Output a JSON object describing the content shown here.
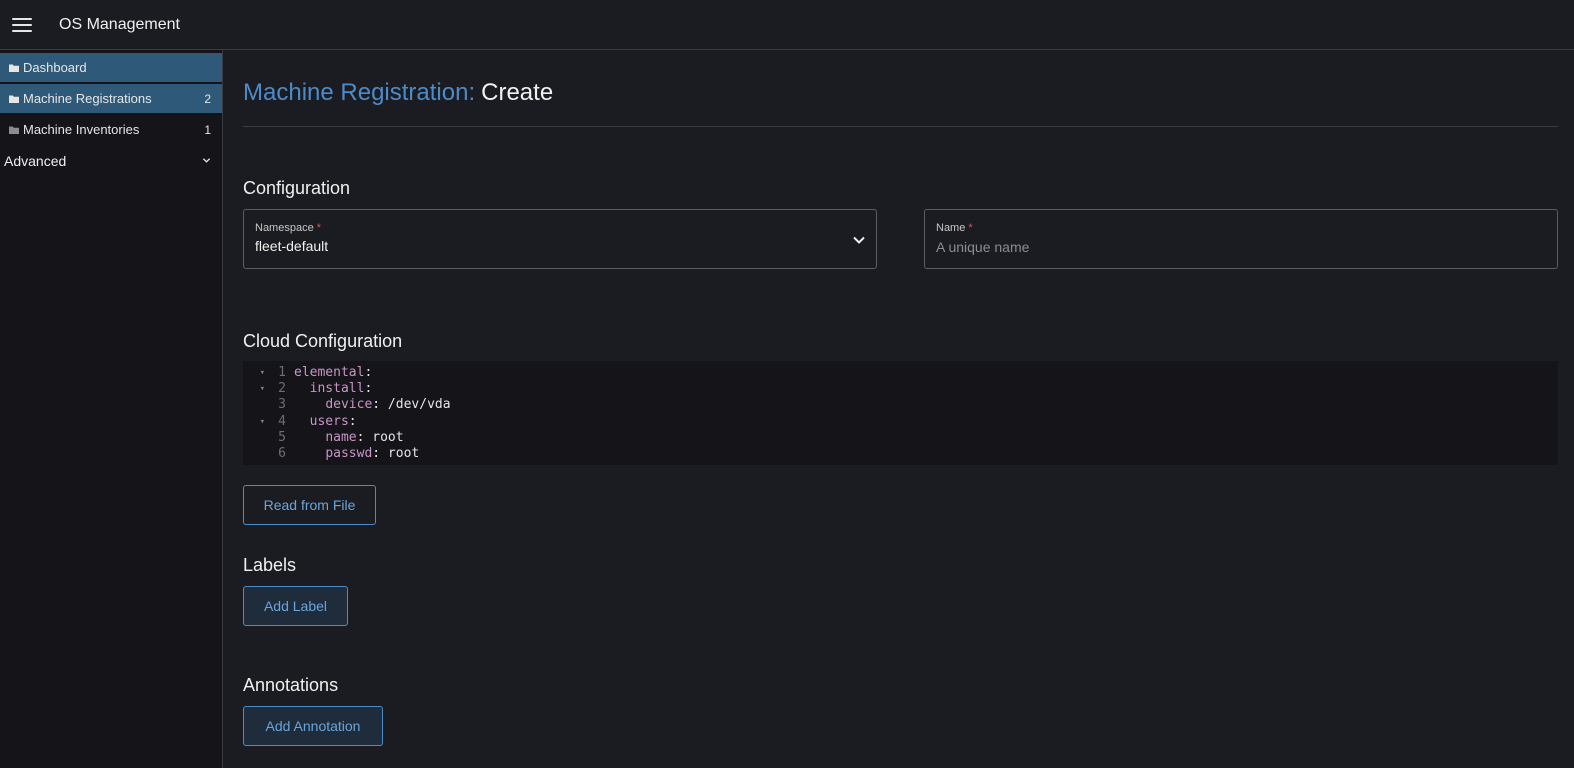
{
  "header": {
    "app_title": "OS Management"
  },
  "sidebar": {
    "items": [
      {
        "label": "Dashboard",
        "count": ""
      },
      {
        "label": "Machine Registrations",
        "count": "2"
      },
      {
        "label": "Machine Inventories",
        "count": "1"
      }
    ],
    "group": {
      "label": "Advanced"
    }
  },
  "page": {
    "title_prefix": "Machine Registration:",
    "title_action": "Create"
  },
  "configuration": {
    "title": "Configuration",
    "namespace": {
      "label": "Namespace",
      "value": "fleet-default"
    },
    "name": {
      "label": "Name",
      "placeholder": "A unique name",
      "value": ""
    }
  },
  "cloud_configuration": {
    "title": "Cloud Configuration",
    "lines": [
      {
        "no": "1",
        "indent": "",
        "key": "elemental",
        "rest": ":"
      },
      {
        "no": "2",
        "indent": "  ",
        "key": "install",
        "rest": ":"
      },
      {
        "no": "3",
        "indent": "    ",
        "key": "device",
        "rest": ": /dev/vda"
      },
      {
        "no": "4",
        "indent": "  ",
        "key": "users",
        "rest": ":"
      },
      {
        "no": "5",
        "indent": "    ",
        "key": "name",
        "rest": ": root"
      },
      {
        "no": "6",
        "indent": "    ",
        "key": "passwd",
        "rest": ": root"
      }
    ],
    "read_button": "Read from File"
  },
  "labels": {
    "title": "Labels",
    "add_button": "Add Label"
  },
  "annotations": {
    "title": "Annotations",
    "add_button": "Add Annotation"
  },
  "colors": {
    "accent": "#4c8bc9",
    "active_nav": "#2f5979",
    "yaml_key": "#c994c7",
    "required": "#d9534f"
  }
}
